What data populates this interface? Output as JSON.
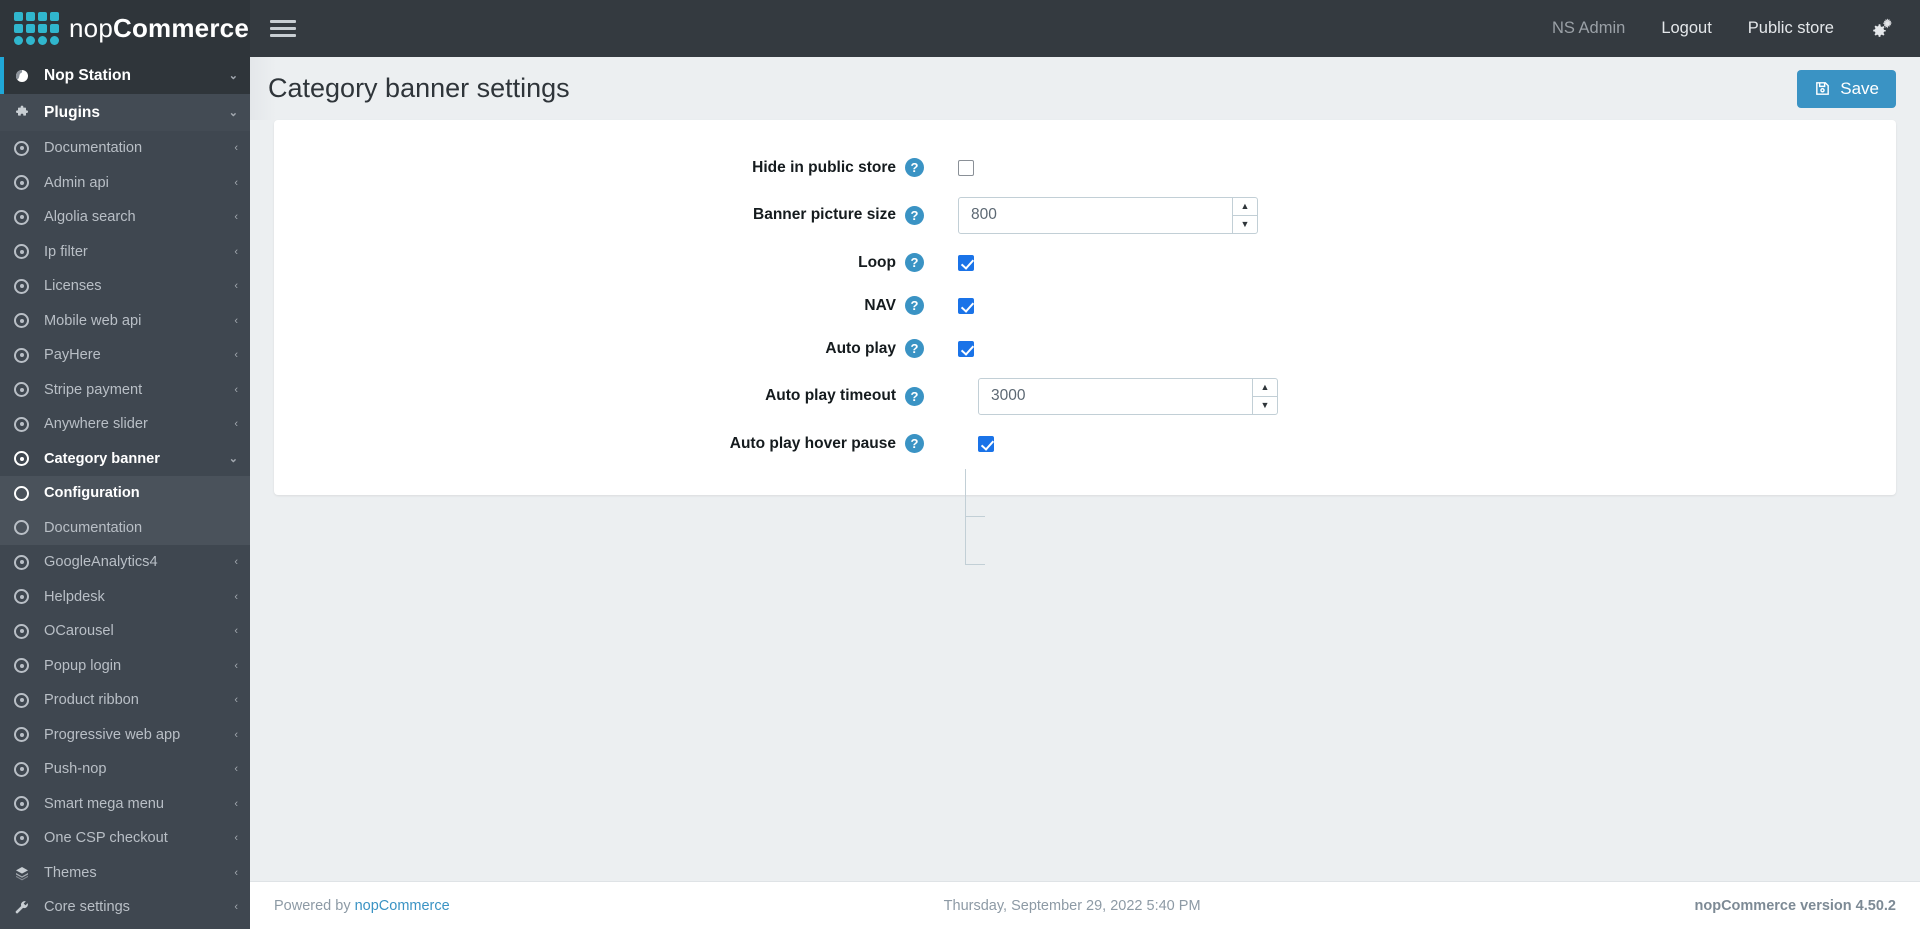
{
  "brand": {
    "name_light": "nop",
    "name_bold": "Commerce"
  },
  "topnav": {
    "hamburger": "menu-icon",
    "user": "NS Admin",
    "logout": "Logout",
    "public_store": "Public store",
    "settings_icon": "gears-icon"
  },
  "sidebar": {
    "root": {
      "label": "Nop Station",
      "icon": "globe-icon",
      "caret": "⌄"
    },
    "section": {
      "label": "Plugins",
      "icon": "puzzle-icon",
      "caret": "⌄"
    },
    "items": [
      {
        "label": "Documentation",
        "icon": "dot-circle-icon",
        "caret": "‹"
      },
      {
        "label": "Admin api",
        "icon": "dot-circle-icon",
        "caret": "‹"
      },
      {
        "label": "Algolia search",
        "icon": "dot-circle-icon",
        "caret": "‹"
      },
      {
        "label": "Ip filter",
        "icon": "dot-circle-icon",
        "caret": "‹"
      },
      {
        "label": "Licenses",
        "icon": "dot-circle-icon",
        "caret": "‹"
      },
      {
        "label": "Mobile web api",
        "icon": "dot-circle-icon",
        "caret": "‹"
      },
      {
        "label": "PayHere",
        "icon": "dot-circle-icon",
        "caret": "‹"
      },
      {
        "label": "Stripe payment",
        "icon": "dot-circle-icon",
        "caret": "‹"
      },
      {
        "label": "Anywhere slider",
        "icon": "dot-circle-icon",
        "caret": "‹"
      },
      {
        "label": "Category banner",
        "icon": "dot-circle-icon",
        "caret": "⌄",
        "expanded": true
      },
      {
        "label": "Configuration",
        "icon": "circle-icon",
        "sub": true,
        "current": true
      },
      {
        "label": "Documentation",
        "icon": "circle-icon",
        "sub": true
      },
      {
        "label": "GoogleAnalytics4",
        "icon": "dot-circle-icon",
        "caret": "‹"
      },
      {
        "label": "Helpdesk",
        "icon": "dot-circle-icon",
        "caret": "‹"
      },
      {
        "label": "OCarousel",
        "icon": "dot-circle-icon",
        "caret": "‹"
      },
      {
        "label": "Popup login",
        "icon": "dot-circle-icon",
        "caret": "‹"
      },
      {
        "label": "Product ribbon",
        "icon": "dot-circle-icon",
        "caret": "‹"
      },
      {
        "label": "Progressive web app",
        "icon": "dot-circle-icon",
        "caret": "‹"
      },
      {
        "label": "Push-nop",
        "icon": "dot-circle-icon",
        "caret": "‹"
      },
      {
        "label": "Smart mega menu",
        "icon": "dot-circle-icon",
        "caret": "‹"
      },
      {
        "label": "One CSP checkout",
        "icon": "dot-circle-icon",
        "caret": "‹"
      },
      {
        "label": "Themes",
        "icon": "layers-icon",
        "caret": "‹",
        "group": true
      },
      {
        "label": "Core settings",
        "icon": "wrench-icon",
        "caret": "‹",
        "group": true
      }
    ]
  },
  "page": {
    "title": "Category banner settings",
    "save_label": "Save",
    "save_icon": "floppy-disk-icon"
  },
  "form": {
    "help_glyph": "?",
    "fields": [
      {
        "label": "Hide in public store",
        "type": "checkbox",
        "checked": false
      },
      {
        "label": "Banner picture size",
        "type": "number",
        "value": "800"
      },
      {
        "label": "Loop",
        "type": "checkbox",
        "checked": true
      },
      {
        "label": "NAV",
        "type": "checkbox",
        "checked": true
      },
      {
        "label": "Auto play",
        "type": "checkbox",
        "checked": true
      },
      {
        "label": "Auto play timeout",
        "type": "number",
        "value": "3000",
        "nested": true
      },
      {
        "label": "Auto play hover pause",
        "type": "checkbox",
        "checked": true,
        "nested": true
      }
    ]
  },
  "footer": {
    "powered_prefix": "Powered by ",
    "powered_link": "nopCommerce",
    "datetime": "Thursday, September 29, 2022 5:40 PM",
    "version": "nopCommerce version 4.50.2"
  },
  "colors": {
    "accent": "#3a93c4",
    "brand_dots": "#30b6cd",
    "sidebar": "#3f4750",
    "header": "#343a40",
    "checkbox": "#1a73e8"
  }
}
